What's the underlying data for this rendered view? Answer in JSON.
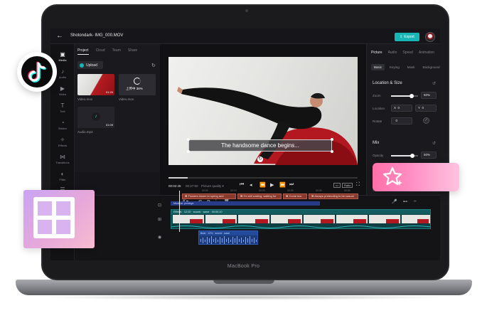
{
  "app": {
    "project_title": "Shotondark- IMG_000.MOV",
    "export_label": "Export",
    "device_label": "MacBook Pro"
  },
  "rail": {
    "items": [
      {
        "label": "Media",
        "icon": "media-icon"
      },
      {
        "label": "Audio",
        "icon": "audio-icon"
      },
      {
        "label": "Video",
        "icon": "video-icon"
      },
      {
        "label": "Text",
        "icon": "text-icon"
      },
      {
        "label": "Sticker",
        "icon": "sticker-icon"
      },
      {
        "label": "Effects",
        "icon": "effects-icon"
      },
      {
        "label": "Transitions",
        "icon": "transitions-icon"
      },
      {
        "label": "Filter",
        "icon": "filter-icon"
      },
      {
        "label": "Adjust",
        "icon": "adjust-icon"
      }
    ]
  },
  "media": {
    "tabs": [
      "Project",
      "Cloud",
      "Team",
      "Share"
    ],
    "upload_label": "Upload",
    "items": [
      {
        "name": "Video.mov",
        "duration": "01:20"
      },
      {
        "name": "Video.mov",
        "duration": "",
        "status": "上传中 38%"
      },
      {
        "name": "Audio.mp3",
        "duration": "01:09"
      }
    ]
  },
  "preview": {
    "subtitle": "The handsome dance begins...",
    "current_time": "00:02:45",
    "total_time": "00:27:50",
    "quality_label": "Picture quality",
    "ratio_label": "Ratio",
    "progress": 0.1
  },
  "props": {
    "tabs": [
      "Picture",
      "Audio",
      "Speed",
      "Animation"
    ],
    "subtabs": [
      "Basic",
      "Keying",
      "Mask",
      "Background"
    ],
    "location_title": "Location & Size",
    "zoom_label": "Zoom",
    "zoom_value": "50%",
    "zoom_level": 0.75,
    "location_label": "Location",
    "x_prefix": "X",
    "x_value": "0",
    "y_prefix": "Y",
    "y_value": "0",
    "rotate_label": "Rotate",
    "rotate_value": "0",
    "mix_title": "Mix",
    "opacity_label": "Opacity",
    "opacity_value": "50%",
    "opacity_level": 0.8
  },
  "timeline": {
    "ruler": [
      "00:00",
      "00:10",
      "00:20",
      "00:30",
      "00:40",
      "00:50",
      "01:00",
      "01:10",
      "01:20"
    ],
    "captions": [
      "Flowers bloom in spring and",
      "I'm still waiting, waiting for",
      "Come tea",
      "Always pretending to be casual"
    ],
    "bgm_label": "Musical: prestige",
    "video_label": "Effects · 12:02 · sound · wave · 00:00:10",
    "audio_label": "Beat · 12% · sound · wave"
  }
}
